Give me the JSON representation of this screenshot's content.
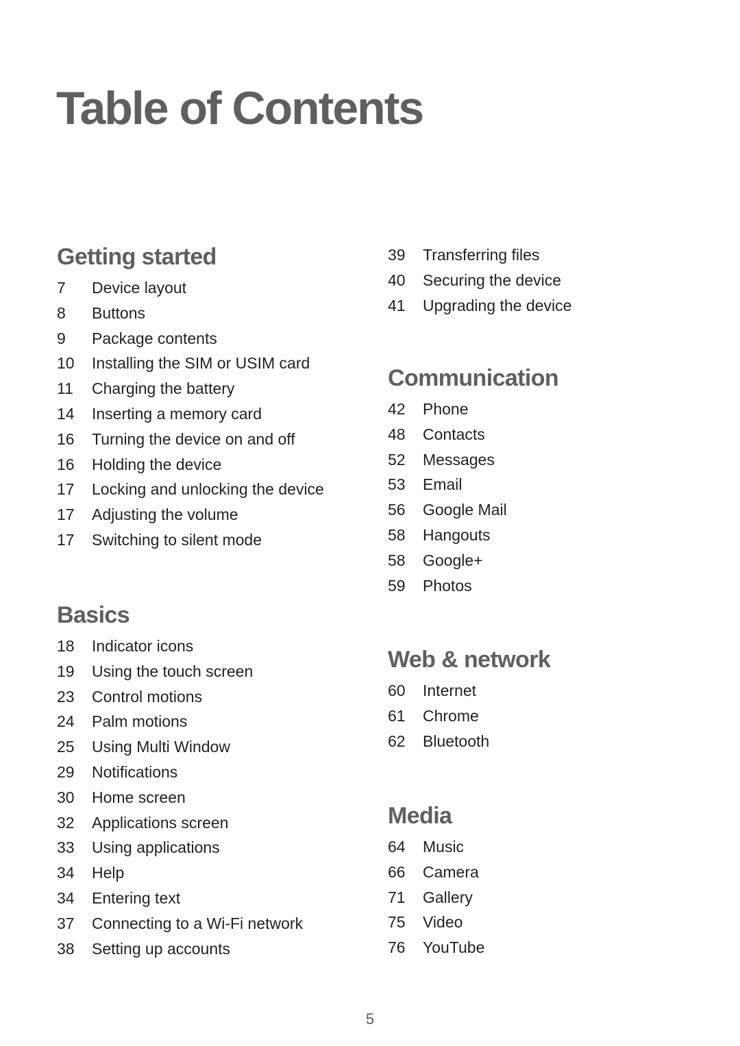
{
  "page": {
    "title": "Table of Contents",
    "page_number": "5"
  },
  "sections": {
    "getting_started": {
      "heading": "Getting started",
      "items": [
        {
          "page": "7",
          "label": "Device layout"
        },
        {
          "page": "8",
          "label": "Buttons"
        },
        {
          "page": "9",
          "label": "Package contents"
        },
        {
          "page": "10",
          "label": "Installing the SIM or USIM card"
        },
        {
          "page": "11",
          "label": "Charging the battery"
        },
        {
          "page": "14",
          "label": "Inserting a memory card"
        },
        {
          "page": "16",
          "label": "Turning the device on and off"
        },
        {
          "page": "16",
          "label": "Holding the device"
        },
        {
          "page": "17",
          "label": "Locking and unlocking the device"
        },
        {
          "page": "17",
          "label": "Adjusting the volume"
        },
        {
          "page": "17",
          "label": "Switching to silent mode"
        }
      ]
    },
    "basics": {
      "heading": "Basics",
      "items": [
        {
          "page": "18",
          "label": "Indicator icons"
        },
        {
          "page": "19",
          "label": "Using the touch screen"
        },
        {
          "page": "23",
          "label": "Control motions"
        },
        {
          "page": "24",
          "label": "Palm motions"
        },
        {
          "page": "25",
          "label": "Using Multi Window"
        },
        {
          "page": "29",
          "label": "Notifications"
        },
        {
          "page": "30",
          "label": "Home screen"
        },
        {
          "page": "32",
          "label": "Applications screen"
        },
        {
          "page": "33",
          "label": "Using applications"
        },
        {
          "page": "34",
          "label": "Help"
        },
        {
          "page": "34",
          "label": "Entering text"
        },
        {
          "page": "37",
          "label": "Connecting to a Wi-Fi network"
        },
        {
          "page": "38",
          "label": "Setting up accounts"
        }
      ]
    },
    "basics_continued": {
      "items": [
        {
          "page": "39",
          "label": "Transferring files"
        },
        {
          "page": "40",
          "label": "Securing the device"
        },
        {
          "page": "41",
          "label": "Upgrading the device"
        }
      ]
    },
    "communication": {
      "heading": "Communication",
      "items": [
        {
          "page": "42",
          "label": "Phone"
        },
        {
          "page": "48",
          "label": "Contacts"
        },
        {
          "page": "52",
          "label": "Messages"
        },
        {
          "page": "53",
          "label": "Email"
        },
        {
          "page": "56",
          "label": "Google Mail"
        },
        {
          "page": "58",
          "label": "Hangouts"
        },
        {
          "page": "58",
          "label": "Google+"
        },
        {
          "page": "59",
          "label": "Photos"
        }
      ]
    },
    "web_network": {
      "heading": "Web & network",
      "items": [
        {
          "page": "60",
          "label": "Internet"
        },
        {
          "page": "61",
          "label": "Chrome"
        },
        {
          "page": "62",
          "label": "Bluetooth"
        }
      ]
    },
    "media": {
      "heading": "Media",
      "items": [
        {
          "page": "64",
          "label": "Music"
        },
        {
          "page": "66",
          "label": "Camera"
        },
        {
          "page": "71",
          "label": "Gallery"
        },
        {
          "page": "75",
          "label": "Video"
        },
        {
          "page": "76",
          "label": "YouTube"
        }
      ]
    }
  },
  "colors": {
    "heading": "#5f5f61",
    "body_text": "#231f20"
  }
}
